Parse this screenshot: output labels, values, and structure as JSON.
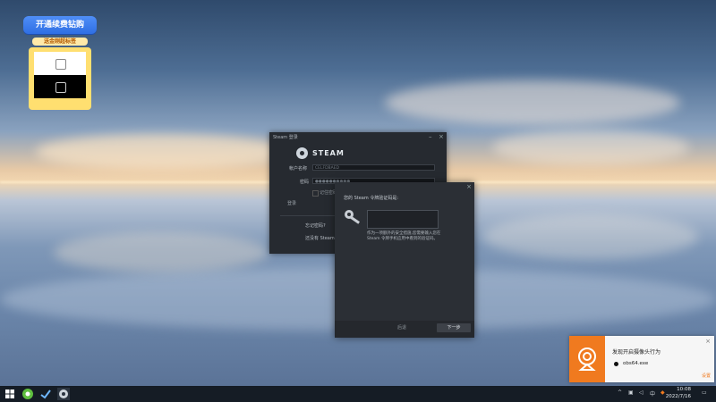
{
  "promo": {
    "title": "开通续费钻购",
    "subtitle": "送金刚超标签"
  },
  "steam_login": {
    "window_title": "Steam 登录",
    "logo_text": "STEAM",
    "username_label": "帐户名称",
    "username_value": "CELFDBAED",
    "password_label": "密码",
    "password_value": "●●●●●●●●●●",
    "remember_label": "记住密码",
    "login_button": "登录",
    "forgot_text": "忘记密码?",
    "no_account_text": "还没有 Steam 帐户?"
  },
  "steam_guard": {
    "question": "您的 Steam 令牌验证码是:",
    "help_text": "作为一项额外的安全措施,您需要输入您在 Steam 令牌手机应用中看到的验证码。",
    "back_button": "后退",
    "next_button": "下一步"
  },
  "notification": {
    "title": "发现开启摄像头行为",
    "app_name": "obs64.exe",
    "settings_link": "设置",
    "accent_color": "#f07a1f"
  },
  "taskbar": {
    "clock_time": "10:08",
    "clock_date": "2022/7/16",
    "start_icon": "windows-logo-icon"
  }
}
